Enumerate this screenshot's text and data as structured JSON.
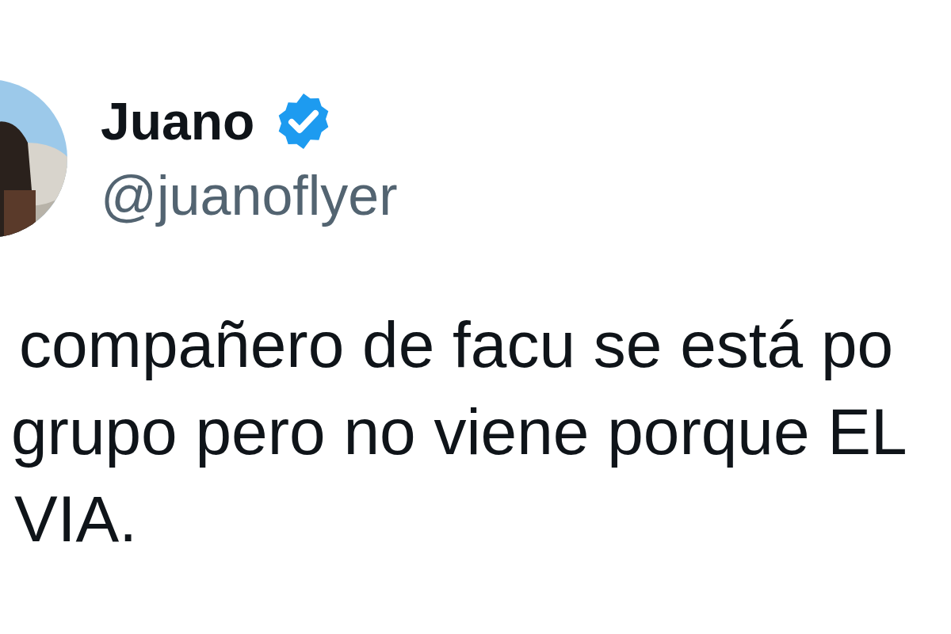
{
  "author": {
    "name": "Juano",
    "verified": true,
    "handle": "@juanoflyer"
  },
  "text_lines": [
    "compañero de facu se está po",
    "grupo pero no viene porque EL",
    "VIA."
  ]
}
